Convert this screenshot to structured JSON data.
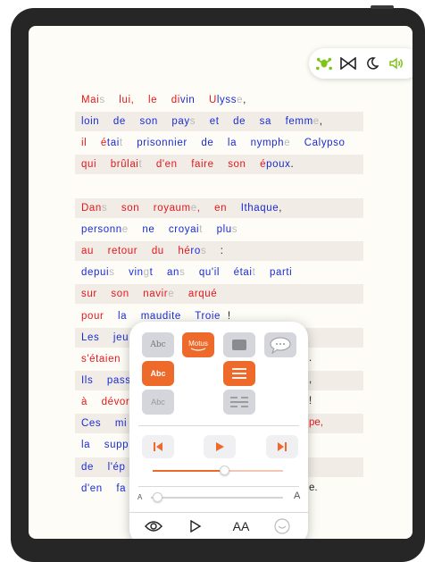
{
  "toolbar": {
    "icons": [
      "frog-icon",
      "bowtie-icon",
      "moon-icon",
      "speaker-icon"
    ],
    "accent": "#7fc31c"
  },
  "text_lines": [
    {
      "segments": [
        [
          "Mai",
          "r"
        ],
        [
          "s",
          "g"
        ],
        [
          "  lui,  le  di",
          "r"
        ],
        [
          "vin",
          "b"
        ],
        [
          "  U",
          "r"
        ],
        [
          "lyss",
          "b"
        ],
        [
          "e",
          "g"
        ],
        [
          ",",
          "k"
        ]
      ]
    },
    {
      "segments": [
        [
          "loin  de  son  pay",
          "b"
        ],
        [
          "s",
          "g"
        ],
        [
          "  et  de  sa  femm",
          "b"
        ],
        [
          "e",
          "g"
        ],
        [
          ",",
          "k"
        ]
      ]
    },
    {
      "segments": [
        [
          "il  é",
          "r"
        ],
        [
          "tai",
          "b"
        ],
        [
          "t",
          "g"
        ],
        [
          "  prisonnier  de  la  nymph",
          "b"
        ],
        [
          "e",
          "g"
        ],
        [
          "  Calypso",
          "b"
        ]
      ]
    },
    {
      "segments": [
        [
          "qui  brûlai",
          "r"
        ],
        [
          "t",
          "g"
        ],
        [
          "  d'en  faire  son  é",
          "r"
        ],
        [
          "poux",
          "b"
        ],
        [
          ".",
          "k"
        ]
      ]
    },
    {
      "segments": []
    },
    {
      "segments": [
        [
          "Dan",
          "r"
        ],
        [
          "s",
          "g"
        ],
        [
          "  son  royaum",
          "r"
        ],
        [
          "e",
          "g"
        ],
        [
          ",  en  ",
          "r"
        ],
        [
          "Ithaque",
          "b"
        ],
        [
          ",",
          "k"
        ]
      ]
    },
    {
      "segments": [
        [
          "personn",
          "b"
        ],
        [
          "e",
          "g"
        ],
        [
          "  ne  croyai",
          "b"
        ],
        [
          "t",
          "g"
        ],
        [
          "  plu",
          "b"
        ],
        [
          "s",
          "g"
        ]
      ]
    },
    {
      "segments": [
        [
          "au  retour  du  hé",
          "r"
        ],
        [
          "ro",
          "b"
        ],
        [
          "s",
          "g"
        ],
        [
          "  :",
          "k"
        ]
      ]
    },
    {
      "segments": [
        [
          "depui",
          "b"
        ],
        [
          "s",
          "g"
        ],
        [
          "  vin",
          "b"
        ],
        [
          "g",
          "g"
        ],
        [
          "t  an",
          "b"
        ],
        [
          "s",
          "g"
        ],
        [
          "  qu'il  é",
          "b"
        ],
        [
          "tai",
          "b"
        ],
        [
          "t",
          "g"
        ],
        [
          "  parti",
          "b"
        ]
      ]
    },
    {
      "segments": [
        [
          "sur  son  navir",
          "r"
        ],
        [
          "e",
          "g"
        ],
        [
          "  arqué",
          "r"
        ]
      ]
    },
    {
      "segments": [
        [
          "pour  ",
          "r"
        ],
        [
          "la  maudite  Troie",
          "b"
        ],
        [
          " !",
          "k"
        ]
      ]
    },
    {
      "segments": [
        [
          "Les  jeu",
          "b"
        ]
      ]
    },
    {
      "segments": [
        [
          "s'étaien",
          "r"
        ]
      ]
    },
    {
      "segments": [
        [
          "Ils  pass",
          "b"
        ]
      ]
    },
    {
      "segments": [
        [
          "à  dévor",
          "r"
        ]
      ]
    },
    {
      "segments": [
        [
          "Ces  mi",
          "b"
        ]
      ]
    },
    {
      "segments": [
        [
          "la  supp",
          "b"
        ]
      ]
    },
    {
      "segments": [
        [
          "de  l'ép",
          "b"
        ]
      ]
    },
    {
      "segments": [
        [
          "d'en  fa",
          "b"
        ]
      ]
    }
  ],
  "right_fragments": [
    {
      "text": ".",
      "row": 12
    },
    {
      "text": ",",
      "row": 13
    },
    {
      "text": "!",
      "row": 14
    },
    {
      "text": "pe,",
      "row": 15
    },
    {
      "text": "e.",
      "row": 18
    }
  ],
  "panel": {
    "tile_abc_serif": "Abc",
    "tile_motus": "Motus",
    "tile_abc_active": "Abc",
    "tile_abc_outline": "Abc",
    "speed_level": 0.55,
    "size_level": 0.05,
    "size_small_label": "A",
    "size_large_label": "A",
    "bottom_font_label": "AA",
    "accent": "#ee6a2a"
  }
}
